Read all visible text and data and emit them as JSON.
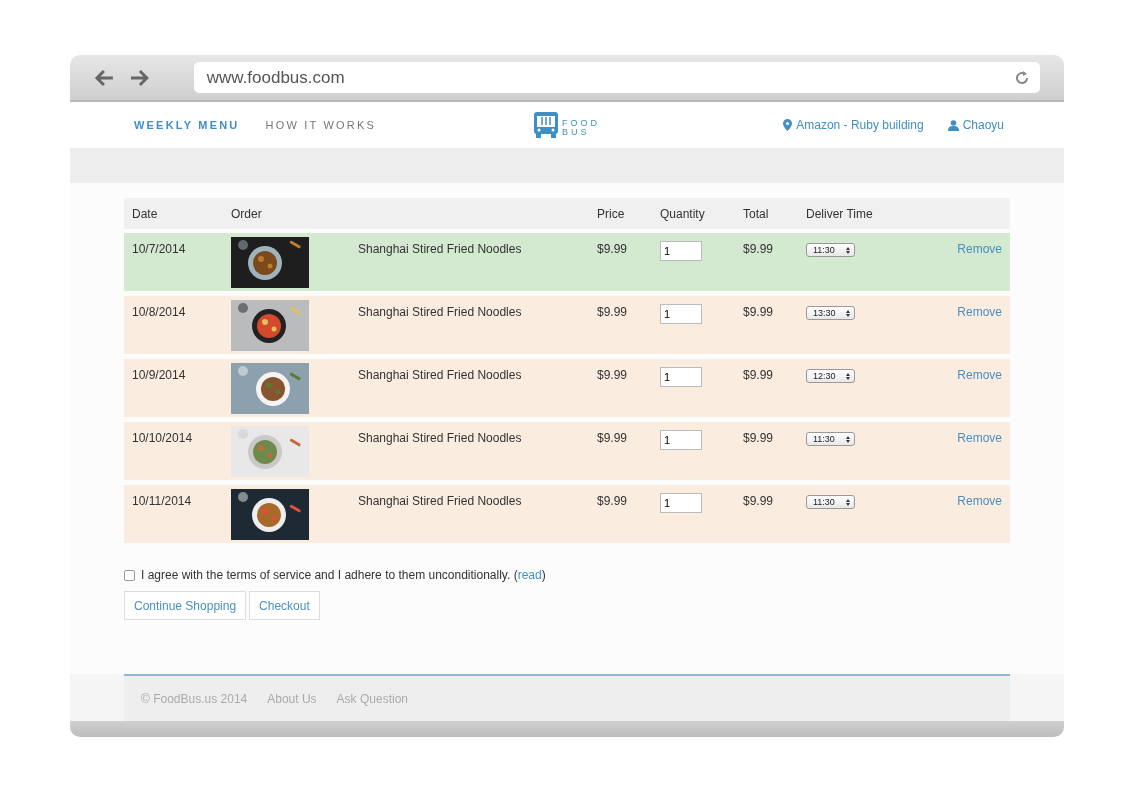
{
  "browser": {
    "url": "www.foodbus.com"
  },
  "nav": {
    "links": [
      {
        "label": "WEEKLY MENU",
        "selected": true
      },
      {
        "label": "HOW IT WORKS",
        "selected": false
      }
    ],
    "logo": {
      "line_1": "FOOD",
      "line_2": "BUS"
    },
    "location": "Amazon - Ruby building",
    "user": "Chaoyu"
  },
  "table": {
    "columns": [
      "Date",
      "Order",
      "Price",
      "Quantity",
      "Total",
      "Deliver Time"
    ],
    "rows": [
      {
        "date": "10/7/2014",
        "item": "Shanghai Stired Fried Noodles",
        "price": "$9.99",
        "quantity": "1",
        "total": "$9.99",
        "deliver_time": "11:30",
        "action": "Remove",
        "selected": true
      },
      {
        "date": "10/8/2014",
        "item": "Shanghai Stired Fried Noodles",
        "price": "$9.99",
        "quantity": "1",
        "total": "$9.99",
        "deliver_time": "13:30",
        "action": "Remove",
        "selected": false
      },
      {
        "date": "10/9/2014",
        "item": "Shanghai Stired Fried Noodles",
        "price": "$9.99",
        "quantity": "1",
        "total": "$9.99",
        "deliver_time": "12:30",
        "action": "Remove",
        "selected": false
      },
      {
        "date": "10/10/2014",
        "item": "Shanghai Stired Fried Noodles",
        "price": "$9.99",
        "quantity": "1",
        "total": "$9.99",
        "deliver_time": "11:30",
        "action": "Remove",
        "selected": false
      },
      {
        "date": "10/11/2014",
        "item": "Shanghai Stired Fried Noodles",
        "price": "$9.99",
        "quantity": "1",
        "total": "$9.99",
        "deliver_time": "11:30",
        "action": "Remove",
        "selected": false
      }
    ]
  },
  "terms": {
    "checked": false,
    "text_before": "I agree with the terms of service and I adhere to them unconditionally. (",
    "link": "read",
    "text_after": ")"
  },
  "buttons": [
    "Continue Shopping",
    "Checkout"
  ],
  "footer": [
    "© FoodBus.us 2014",
    "About Us",
    "Ask Question"
  ]
}
